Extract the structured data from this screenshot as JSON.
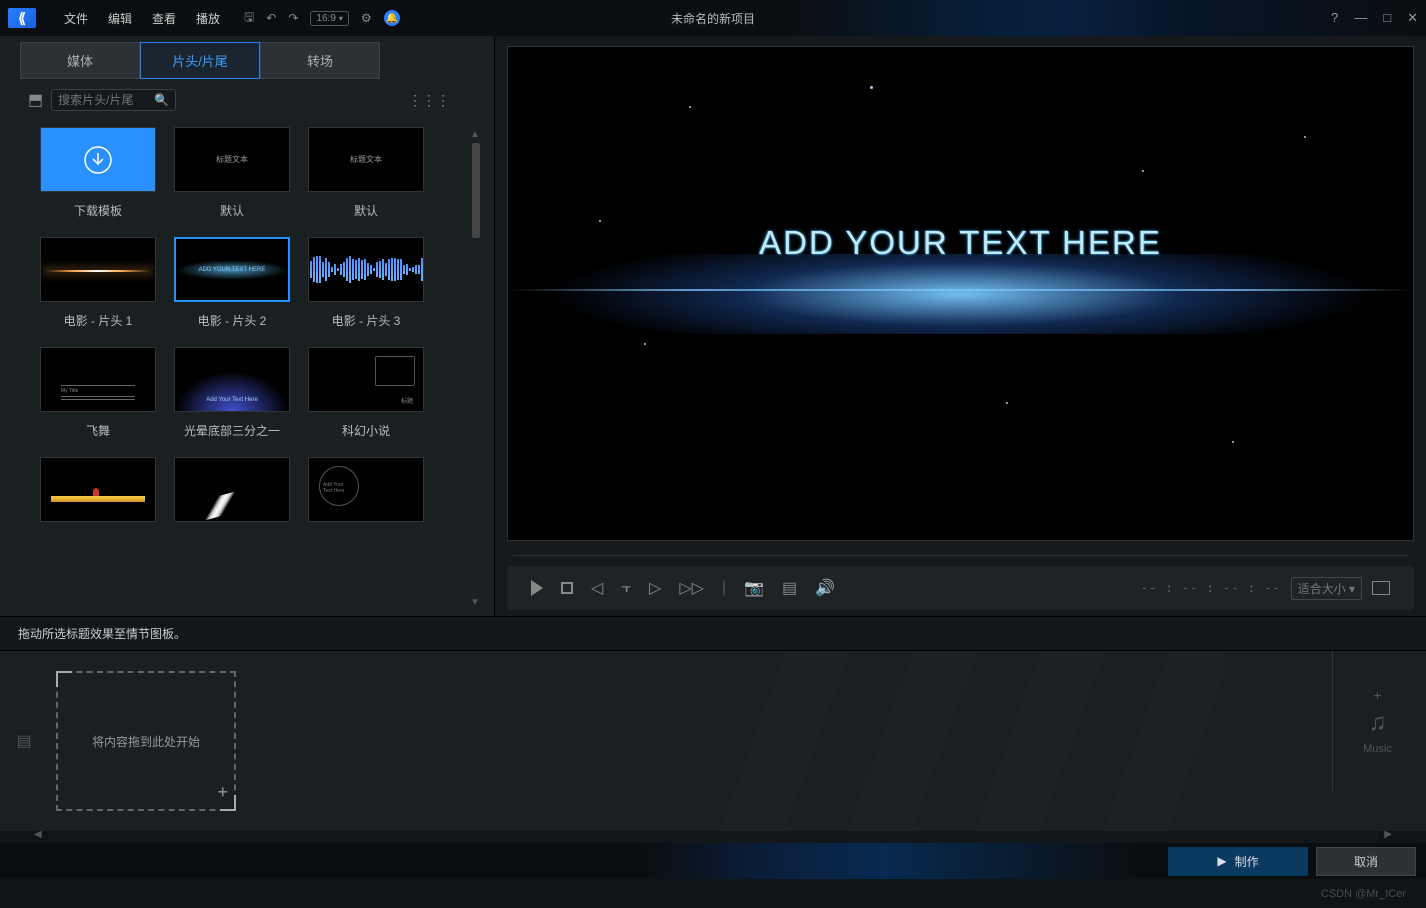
{
  "app": {
    "project_title": "未命名的新项目",
    "aspect_ratio": "16:9"
  },
  "menus": {
    "file": "文件",
    "edit": "编辑",
    "view": "查看",
    "play": "播放"
  },
  "window": {
    "help": "?",
    "min": "—",
    "max": "□",
    "close": "✕"
  },
  "tabs": {
    "media": "媒体",
    "titles": "片头/片尾",
    "transitions": "转场",
    "active": "titles"
  },
  "search": {
    "placeholder": "搜索片头/片尾"
  },
  "templates": [
    {
      "id": "download",
      "label": "下载模板",
      "kind": "dl"
    },
    {
      "id": "default1",
      "label": "默认",
      "kind": "text"
    },
    {
      "id": "default2",
      "label": "默认",
      "kind": "text"
    },
    {
      "id": "movie1",
      "label": "电影 - 片头 1",
      "kind": "flare"
    },
    {
      "id": "movie2",
      "label": "电影 - 片头 2",
      "kind": "flare2",
      "selected": true
    },
    {
      "id": "movie3",
      "label": "电影 - 片头 3",
      "kind": "wave"
    },
    {
      "id": "fly",
      "label": "飞舞",
      "kind": "lines"
    },
    {
      "id": "glow",
      "label": "光晕底部三分之一",
      "kind": "blueglow"
    },
    {
      "id": "scifi",
      "label": "科幻小说",
      "kind": "wire"
    },
    {
      "id": "t10",
      "label": "",
      "kind": "yellow"
    },
    {
      "id": "t11",
      "label": "",
      "kind": "sword"
    },
    {
      "id": "t12",
      "label": "",
      "kind": "circle"
    }
  ],
  "preview": {
    "overlay_text": "ADD YOUR TEXT HERE",
    "timecode": "-- : -- : -- : --",
    "fit_label": "适合大小"
  },
  "storyboard": {
    "hint": "拖动所选标题效果至情节图板。",
    "drop_hint": "将内容拖到此处开始",
    "music_label": "Music"
  },
  "actions": {
    "produce": "制作",
    "cancel": "取消"
  },
  "watermark": "CSDN @Mr_ICer"
}
